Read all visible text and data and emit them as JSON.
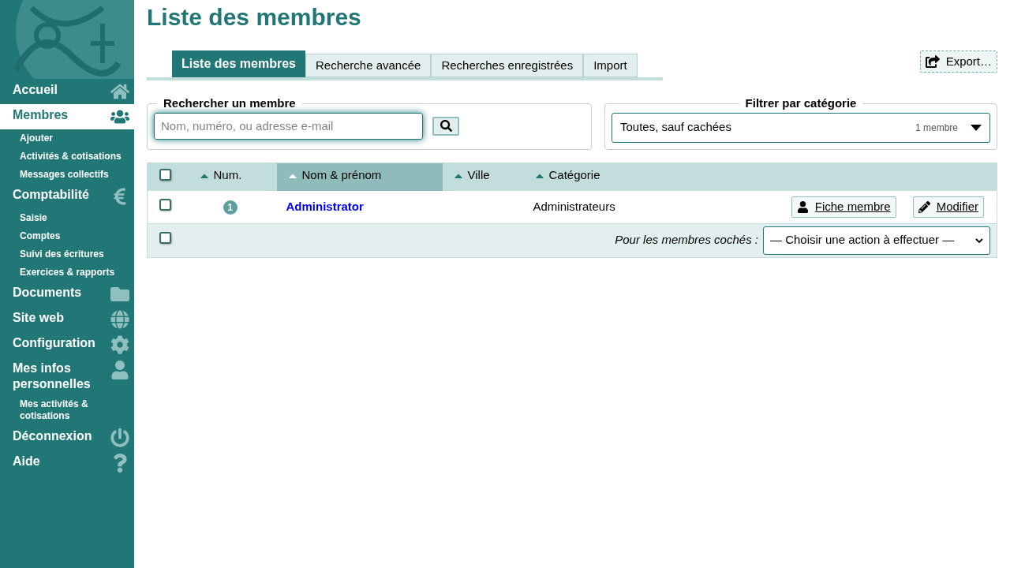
{
  "sidebar": {
    "items": [
      {
        "label": "Accueil",
        "selected": false
      },
      {
        "label": "Membres",
        "selected": true,
        "children": [
          {
            "label": "Ajouter"
          },
          {
            "label": "Activités & cotisations"
          },
          {
            "label": "Messages collectifs"
          }
        ]
      },
      {
        "label": "Comptabilité",
        "selected": false,
        "children": [
          {
            "label": "Saisie"
          },
          {
            "label": "Comptes"
          },
          {
            "label": "Suivi des écritures"
          },
          {
            "label": "Exercices & rapports"
          }
        ]
      },
      {
        "label": "Documents",
        "selected": false
      },
      {
        "label": "Site web",
        "selected": false
      },
      {
        "label": "Configuration",
        "selected": false
      },
      {
        "label": "Mes infos personnelles",
        "selected": false,
        "children": [
          {
            "label": "Mes activités & cotisations"
          }
        ]
      },
      {
        "label": "Déconnexion",
        "selected": false
      },
      {
        "label": "Aide",
        "selected": false
      }
    ]
  },
  "title": "Liste des membres",
  "tabs": [
    {
      "label": "Liste des membres",
      "selected": true
    },
    {
      "label": "Recherche avancée",
      "selected": false
    },
    {
      "label": "Recherches enregistrées",
      "selected": false
    },
    {
      "label": "Import",
      "selected": false
    }
  ],
  "export_button": "Export…",
  "search": {
    "legend": "Rechercher un membre",
    "placeholder": "Nom, numéro, ou adresse e-mail"
  },
  "filter": {
    "legend": "Filtrer par catégorie",
    "value": "Toutes, sauf cachées",
    "count": "1 membre"
  },
  "table": {
    "header_checkbox": {
      "checked": false
    },
    "columns": [
      {
        "label": "Num.",
        "selected": false
      },
      {
        "label": "Nom & prénom",
        "selected": true
      },
      {
        "label": "Ville",
        "selected": false
      },
      {
        "label": "Catégorie",
        "selected": false
      }
    ],
    "rows": [
      {
        "checked": false,
        "num": "1",
        "name": "Administrator",
        "category": "Administrateurs",
        "actions": [
          "Fiche membre",
          "Modifier"
        ]
      }
    ],
    "footer": {
      "checked": false,
      "label": "Pour les membres cochés :",
      "action": "— Choisir une action à effectuer —"
    }
  }
}
